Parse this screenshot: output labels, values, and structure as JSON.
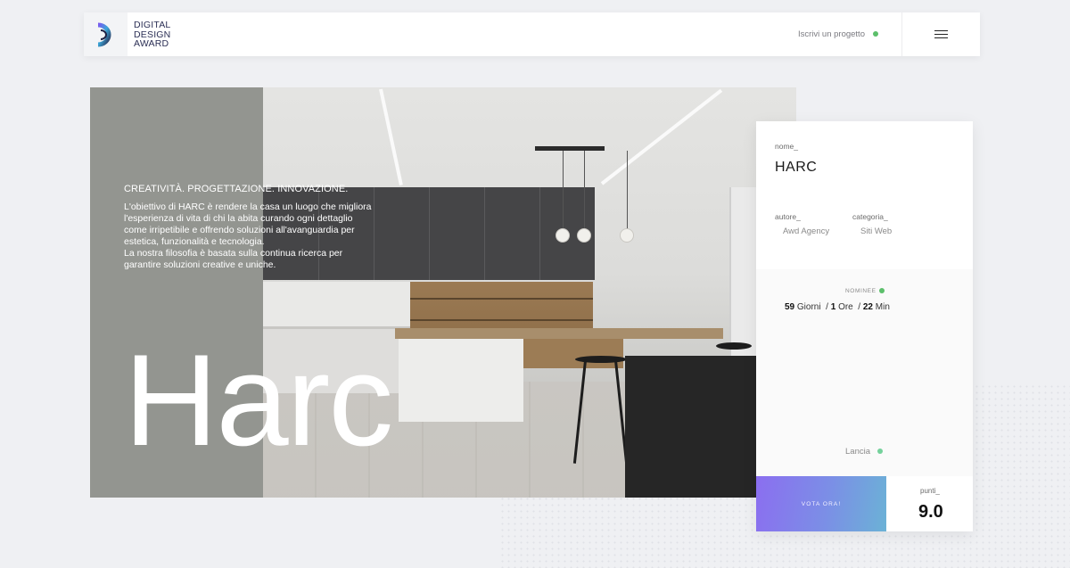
{
  "header": {
    "logo_lines": [
      "DIGITAL",
      "DESIGN",
      "AWARD"
    ],
    "cta_label": "Iscrivi un progetto",
    "menu_icon": "hamburger-menu-icon"
  },
  "hero": {
    "tagline": "CREATIVITÀ. PROGETTAZIONE. INNOVAZIONE.",
    "description_lines": [
      "L'obiettivo di HARC è rendere la casa un luogo che migliora",
      "l'esperienza di vita di chi la abita curando ogni dettaglio",
      "come irripetibile e offrendo soluzioni all'avanguardia per",
      "estetica, funzionalità e tecnologia.",
      "La nostra filosofia è basata sulla continua ricerca per",
      "garantire soluzioni creative e uniche."
    ],
    "title": "Harc"
  },
  "card": {
    "name_label": "nome_",
    "name_value": "HARC",
    "author_label": "autore_",
    "author_value": "Awd Agency",
    "category_label": "categoria_",
    "category_value": "Siti Web",
    "status_label": "NOMINEE",
    "countdown": {
      "days": "59",
      "days_unit": "Giorni",
      "hours": "1",
      "hours_unit": "Ore",
      "minutes": "22",
      "minutes_unit": "Min",
      "separator": "/"
    },
    "launch_label": "Lancia",
    "vote_label": "VOTA ORA!",
    "points_label": "punti_",
    "points_value": "9.0"
  },
  "colors": {
    "accent_green": "#5cbf6b",
    "vote_gradient_start": "#8b6ef0",
    "vote_gradient_end": "#6bb2d6",
    "background": "#eff0f3"
  }
}
